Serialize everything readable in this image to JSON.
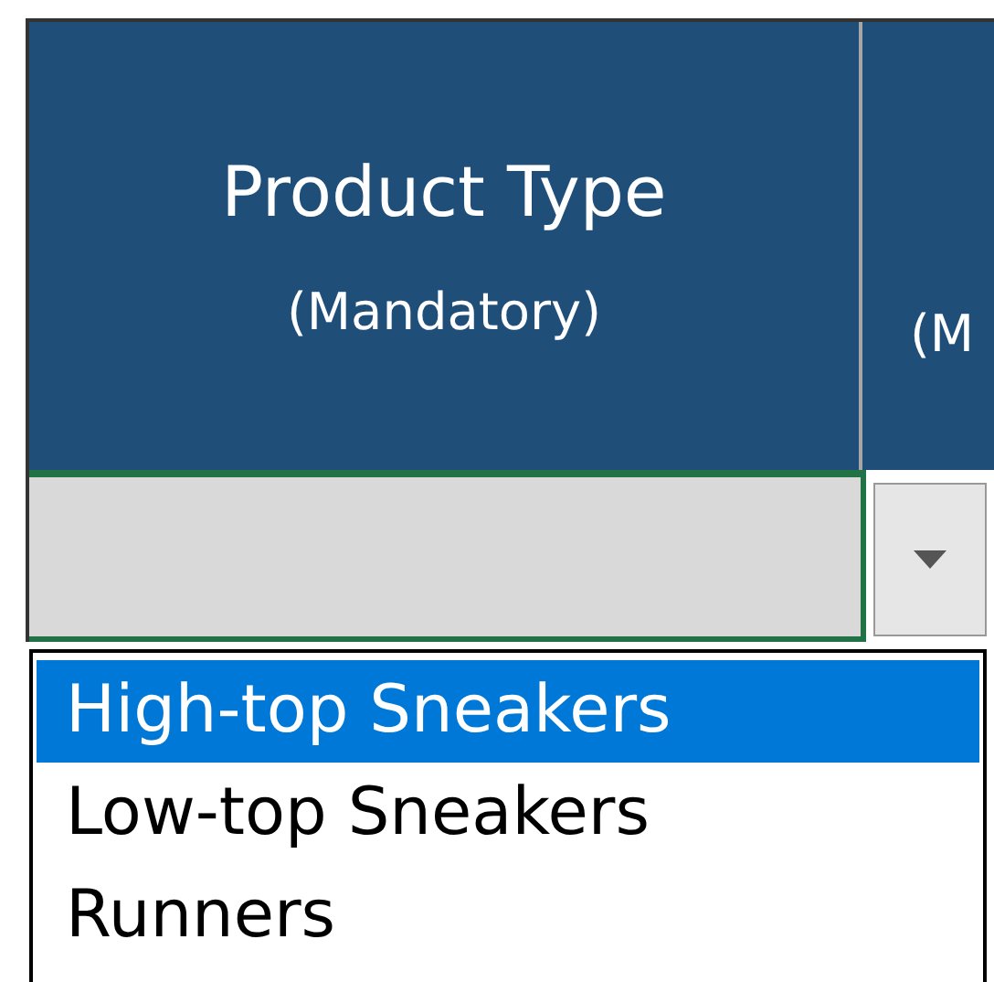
{
  "columns": [
    {
      "title": "Product Type",
      "subtitle": "(Mandatory)"
    },
    {
      "subtitle": "(M"
    }
  ],
  "dropdown": {
    "expanded": true,
    "options": [
      {
        "label": "High-top Sneakers",
        "selected": true
      },
      {
        "label": "Low-top Sneakers",
        "selected": false
      },
      {
        "label": "Runners",
        "selected": false
      }
    ]
  }
}
